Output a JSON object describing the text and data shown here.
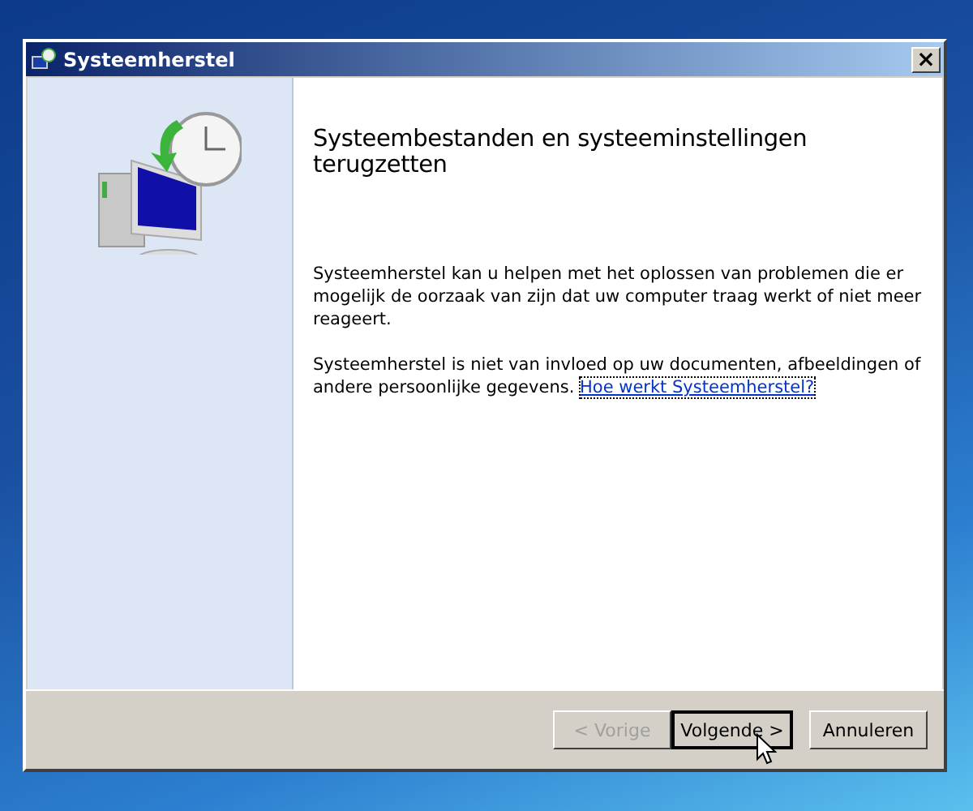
{
  "window": {
    "title": "Systeemherstel",
    "close": "×"
  },
  "heading": "Systeembestanden en systeeminstellingen terugzetten",
  "paragraphs": [
    {
      "text": "Systeemherstel kan u helpen met het oplossen van problemen die er mogelijk de oorzaak van zijn dat uw computer traag werkt of niet meer reageert."
    },
    {
      "text": "Systeemherstel is niet van invloed op uw documenten, afbeeldingen of andere persoonlijke gegevens.",
      "link": "Hoe werkt Systeemherstel?"
    }
  ],
  "buttons": [
    {
      "label": "< Vorige",
      "disabled": true,
      "default": false
    },
    {
      "label": "Volgende >",
      "disabled": false,
      "default": true
    },
    {
      "label": "Annuleren",
      "disabled": false,
      "default": false
    }
  ]
}
